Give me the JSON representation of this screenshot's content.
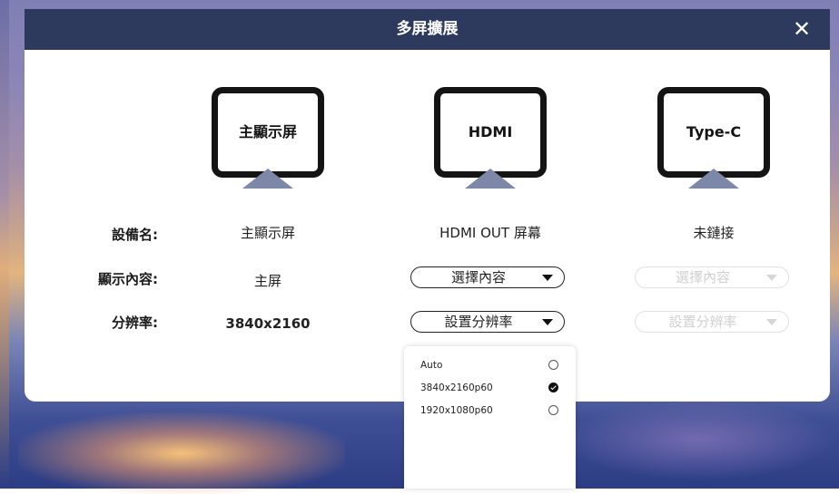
{
  "dialog": {
    "title": "多屏擴展",
    "close_label": "✕"
  },
  "displays": [
    {
      "label": "主顯示屏",
      "icon": "monitor-icon"
    },
    {
      "label": "HDMI",
      "icon": "monitor-icon"
    },
    {
      "label": "Type-C",
      "icon": "monitor-icon"
    }
  ],
  "rows": {
    "device_name": {
      "label": "設備名:",
      "values": [
        "主顯示屏",
        "HDMI OUT 屏幕",
        "未鏈接"
      ]
    },
    "display_content": {
      "label": "顯示內容:",
      "main_value": "主屏",
      "hdmi_select": "選擇內容",
      "typec_select": "選擇內容"
    },
    "resolution": {
      "label": "分辨率:",
      "main_value": "3840x2160",
      "hdmi_select": "設置分辨率",
      "typec_select": "設置分辨率"
    }
  },
  "resolution_dropdown": {
    "options": [
      {
        "label": "Auto",
        "selected": false
      },
      {
        "label": "3840x2160p60",
        "selected": true
      },
      {
        "label": "1920x1080p60",
        "selected": false
      }
    ]
  },
  "colors": {
    "title_bar": "#2d3a5e",
    "monitor_stand": "#7d88a8"
  }
}
